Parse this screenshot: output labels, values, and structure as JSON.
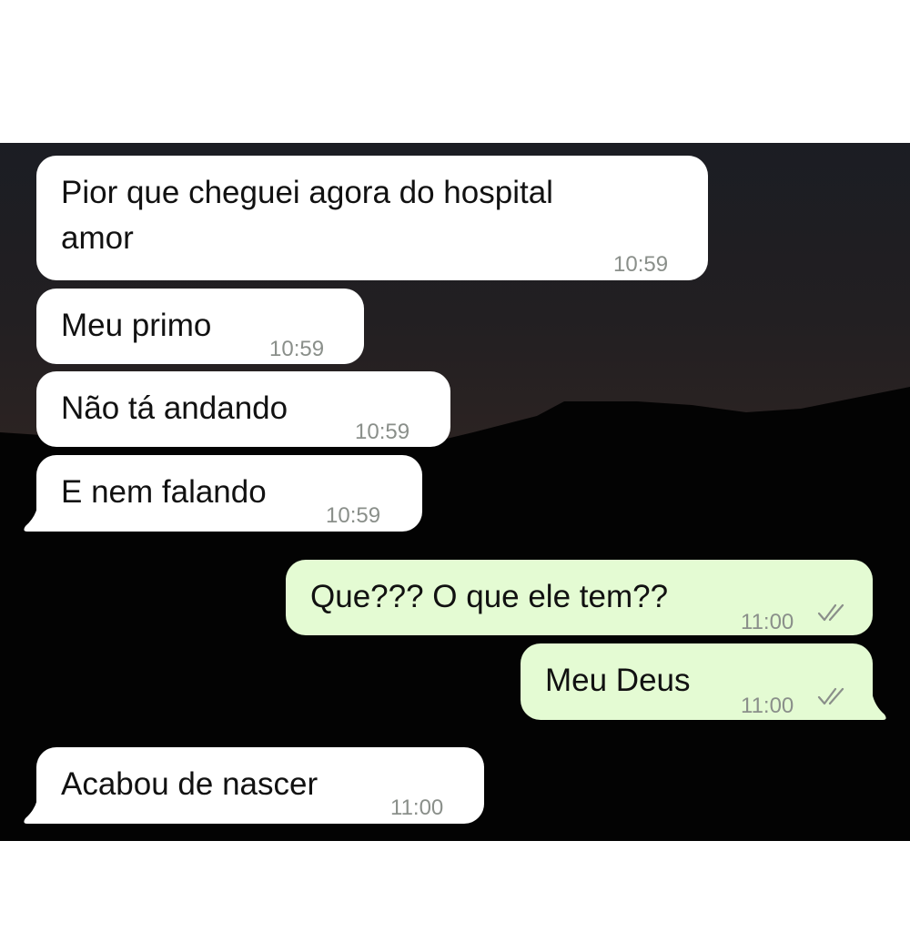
{
  "messages": [
    {
      "direction": "incoming",
      "text": "Pior que cheguei agora do hospital\namor",
      "time": "10:59"
    },
    {
      "direction": "incoming",
      "text": "Meu primo",
      "time": "10:59"
    },
    {
      "direction": "incoming",
      "text": "Não tá andando",
      "time": "10:59"
    },
    {
      "direction": "incoming",
      "text": "E nem falando",
      "time": "10:59"
    },
    {
      "direction": "outgoing",
      "text": "Que??? O que ele tem??",
      "time": "11:00",
      "status_icon": "double-check-icon"
    },
    {
      "direction": "outgoing",
      "text": "Meu Deus",
      "time": "11:00",
      "status_icon": "double-check-icon"
    },
    {
      "direction": "incoming",
      "text": "Acabou de nascer",
      "time": "11:00"
    }
  ],
  "colors": {
    "incoming_bubble": "#ffffff",
    "outgoing_bubble": "#e4fbd3",
    "timestamp": "#8a8f8a",
    "ticks": "#8a8f8a"
  }
}
